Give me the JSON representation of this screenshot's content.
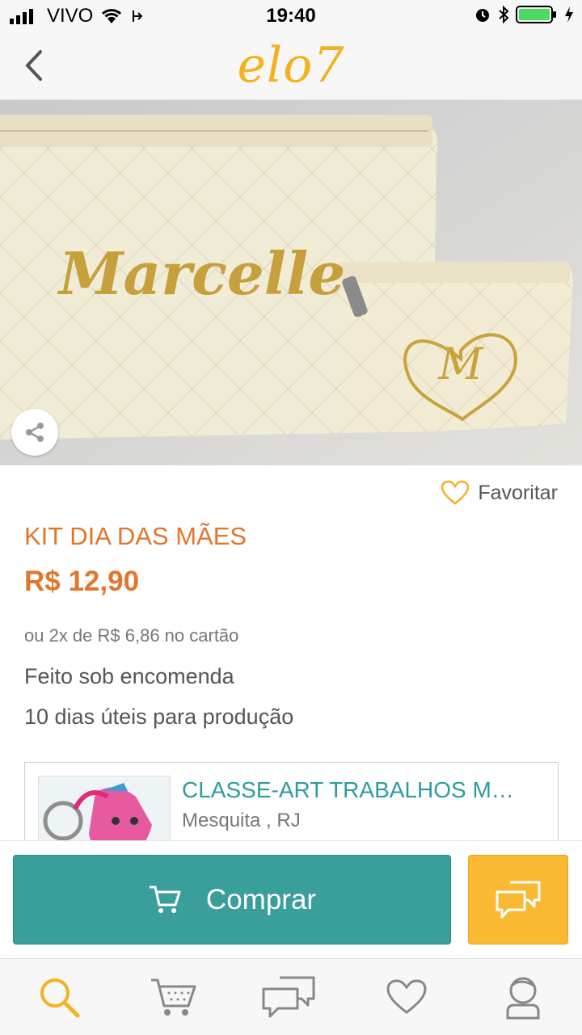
{
  "status_bar": {
    "carrier": "VIVO",
    "time": "19:40"
  },
  "header": {
    "logo": "elo7",
    "back_icon": "chevron-left-icon"
  },
  "product": {
    "title": "KIT DIA DAS MÃES",
    "price": "R$ 12,90",
    "installments": "ou 2x de R$ 6,86 no cartão",
    "made_to_order": "Feito sob encomenda",
    "production_time": "10 dias úteis para produção",
    "favorite_label": "Favoritar",
    "image_text_name": "Marcelle",
    "image_text_initial": "M"
  },
  "store": {
    "name": "CLASSE-ART TRABALHOS M…",
    "location": "Mesquita , RJ"
  },
  "actions": {
    "buy_label": "Comprar",
    "chat_icon": "chat-bubbles-icon"
  },
  "tabs": [
    {
      "icon": "search-icon"
    },
    {
      "icon": "cart-icon"
    },
    {
      "icon": "messages-icon"
    },
    {
      "icon": "heart-icon"
    },
    {
      "icon": "profile-icon"
    }
  ],
  "colors": {
    "brand": "#f5b11e",
    "price": "#e3762b",
    "teal": "#3a9e9b",
    "chat_yellow": "#f9b932"
  }
}
